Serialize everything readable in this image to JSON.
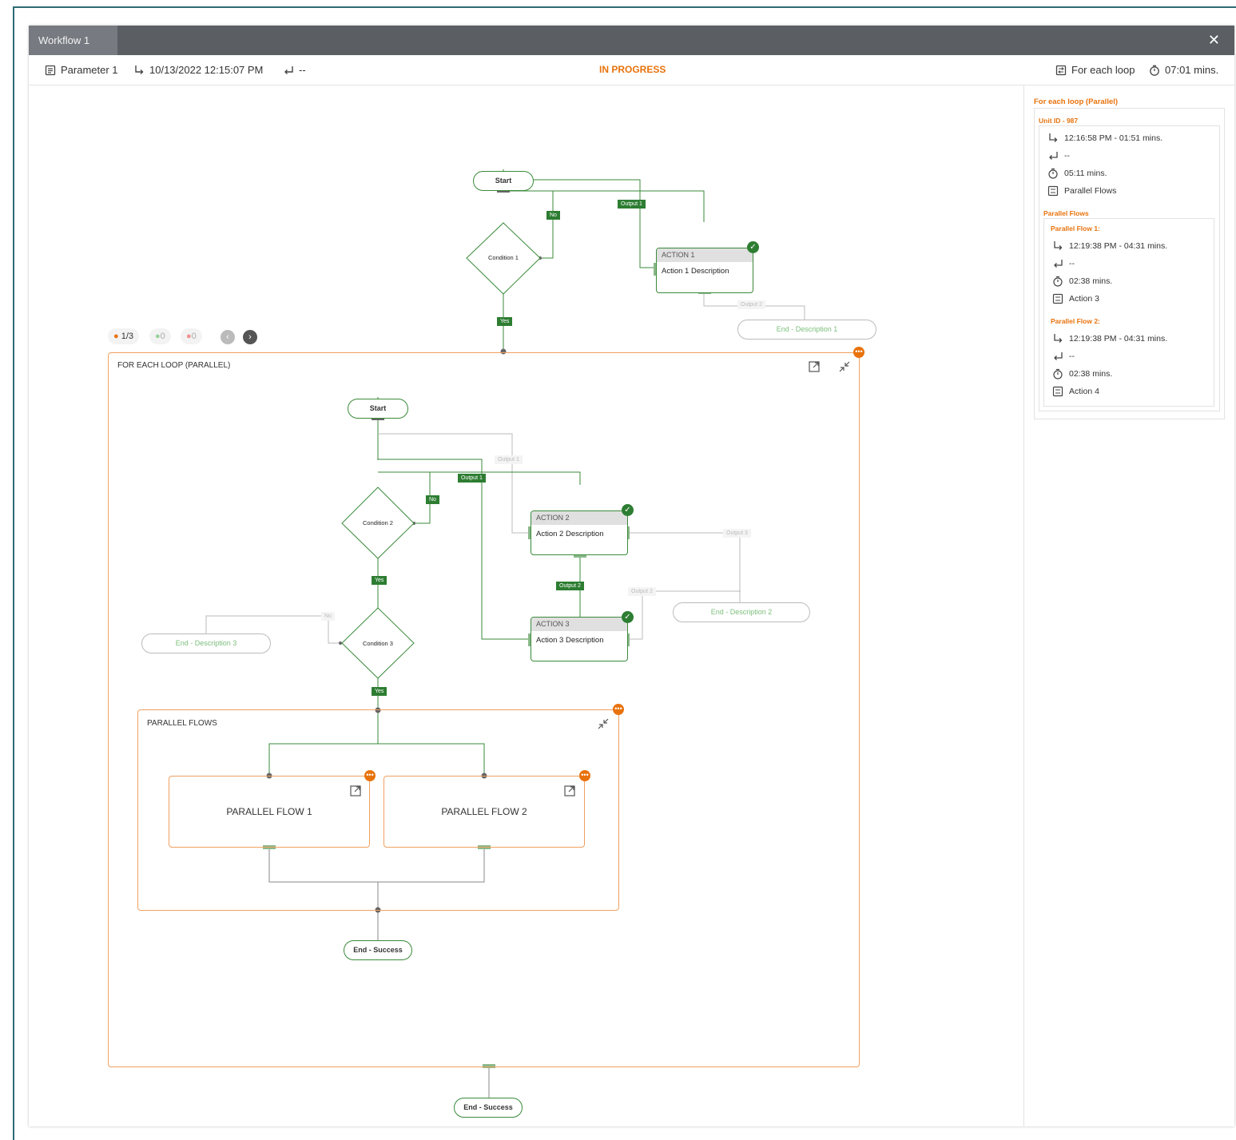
{
  "window": {
    "tab_title": "Workflow 1",
    "close_icon": "close-icon"
  },
  "toolbar": {
    "parameter": "Parameter 1",
    "start_time": "10/13/2022 12:15:07 PM",
    "end_time": "--",
    "status": "IN PROGRESS",
    "current_step": "For each loop",
    "duration": "07:01 mins."
  },
  "colors": {
    "accent": "#e8720c",
    "success": "#2d7d32",
    "titlebar": "#5b5e63"
  },
  "pager": {
    "active": "1/3",
    "grey_count": "0",
    "red_count": "0"
  },
  "flow": {
    "start1": "Start",
    "condition1": "Condition 1",
    "action1_title": "ACTION 1",
    "action1_desc": "Action 1 Description",
    "output1": "Output 1",
    "output2": "Output 2",
    "no": "No",
    "yes": "Yes",
    "end_desc1": "End - Description 1",
    "loop_title": "FOR EACH LOOP (PARALLEL)",
    "start2": "Start",
    "condition2": "Condition 2",
    "condition3": "Condition 3",
    "action2_title": "ACTION 2",
    "action2_desc": "Action 2 Description",
    "action3_title": "ACTION 3",
    "action3_desc": "Action 3 Description",
    "output1_faded": "Output 1",
    "output1_b": "Output 1",
    "output2_b": "Output 2",
    "output2_faded": "Output 2",
    "output3": "Output 3",
    "no2": "No",
    "no3": "No",
    "yes2": "Yes",
    "yes3": "Yes",
    "end_desc2": "End - Description 2",
    "end_desc3": "End - Description 3",
    "parallel_title": "PARALLEL FLOWS",
    "pf1": "PARALLEL FLOW 1",
    "pf2": "PARALLEL FLOW 2",
    "end_success_inner": "End - Success",
    "end_success_outer": "End - Success"
  },
  "side": {
    "title": "For each loop (Parallel)",
    "unit": "Unit ID - 987",
    "unit_start": "12:16:58 PM - 01:51 mins.",
    "unit_end": "--",
    "unit_duration": "05:11 mins.",
    "unit_step": "Parallel Flows",
    "parallel_heading": "Parallel Flows",
    "pf1_title": "Parallel Flow 1:",
    "pf1_start": "12:19:38 PM - 04:31 mins.",
    "pf1_end": "--",
    "pf1_duration": "02:38 mins.",
    "pf1_step": "Action 3",
    "pf2_title": "Parallel Flow 2:",
    "pf2_start": "12:19:38 PM - 04:31 mins.",
    "pf2_end": "--",
    "pf2_duration": "02:38 mins.",
    "pf2_step": "Action 4"
  }
}
